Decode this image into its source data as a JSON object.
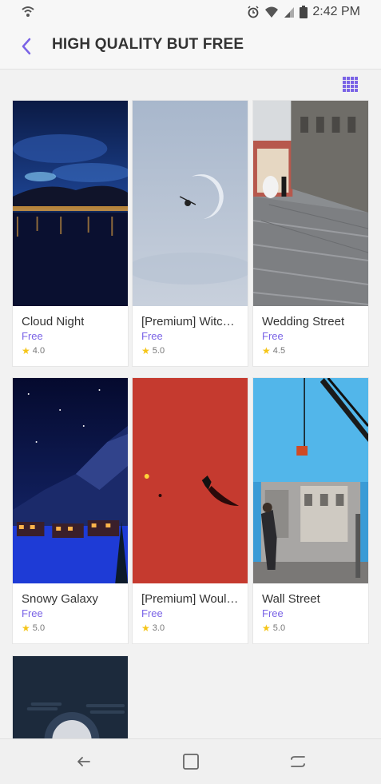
{
  "status": {
    "time": "2:42 PM",
    "icons": [
      "alarm-icon",
      "wifi-icon",
      "signal-icon",
      "battery-icon"
    ]
  },
  "header": {
    "title": "HIGH QUALITY BUT FREE",
    "back_icon": "chevron-left-icon",
    "view_icon": "grid-view-icon",
    "accent": "#7a63e6"
  },
  "items": [
    {
      "name": "Cloud Night",
      "price": "Free",
      "rating": "4.0"
    },
    {
      "name": "[Premium] Witchy...",
      "price": "Free",
      "rating": "5.0"
    },
    {
      "name": "Wedding Street",
      "price": "Free",
      "rating": "4.5"
    },
    {
      "name": "Snowy Galaxy",
      "price": "Free",
      "rating": "5.0"
    },
    {
      "name": "[Premium] Would ...",
      "price": "Free",
      "rating": "3.0"
    },
    {
      "name": "Wall Street",
      "price": "Free",
      "rating": "5.0"
    }
  ],
  "navbar": {
    "icons": [
      "back-icon",
      "home-icon",
      "recents-icon"
    ]
  }
}
